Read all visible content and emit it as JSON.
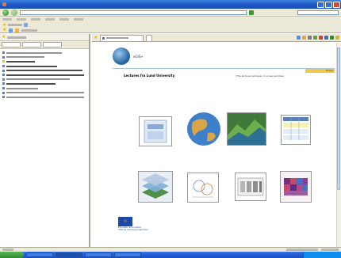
{
  "window": {
    "title": ""
  },
  "browser": {
    "address": "",
    "search_placeholder": "",
    "tab_label": ""
  },
  "sidebar": {
    "title": "",
    "items": [
      "",
      "",
      "",
      "",
      "",
      "",
      "",
      "",
      "",
      "",
      "",
      ""
    ]
  },
  "page": {
    "brand": "eGIS+",
    "home_label": "Home",
    "section_title": "Lectures fra Lund University",
    "note": "(The lectures will open in a new window)",
    "lectures": [
      {
        "caption": "",
        "icon": "gis-book-cover-icon"
      },
      {
        "caption": "",
        "icon": "globe-map-icon"
      },
      {
        "caption": "",
        "icon": "terrain-3d-icon"
      },
      {
        "caption": "",
        "icon": "database-table-icon"
      },
      {
        "caption": "",
        "icon": "raster-layers-icon"
      },
      {
        "caption": "",
        "icon": "vector-analysis-icon"
      },
      {
        "caption": "",
        "icon": "cells-grid-icon"
      },
      {
        "caption": "",
        "icon": "raster-map-icon"
      }
    ],
    "eu_logo": {
      "line1": "Education and Culture",
      "line2": "Lifelong learning programme"
    }
  },
  "colors": {
    "titlebar": "#1d56c6",
    "taskbar": "#245edb",
    "start_button": "#2e8b2e",
    "header_rule": "#a8c1de",
    "home_bar": "#f0c845",
    "caption_text": "#2a4d8a"
  }
}
